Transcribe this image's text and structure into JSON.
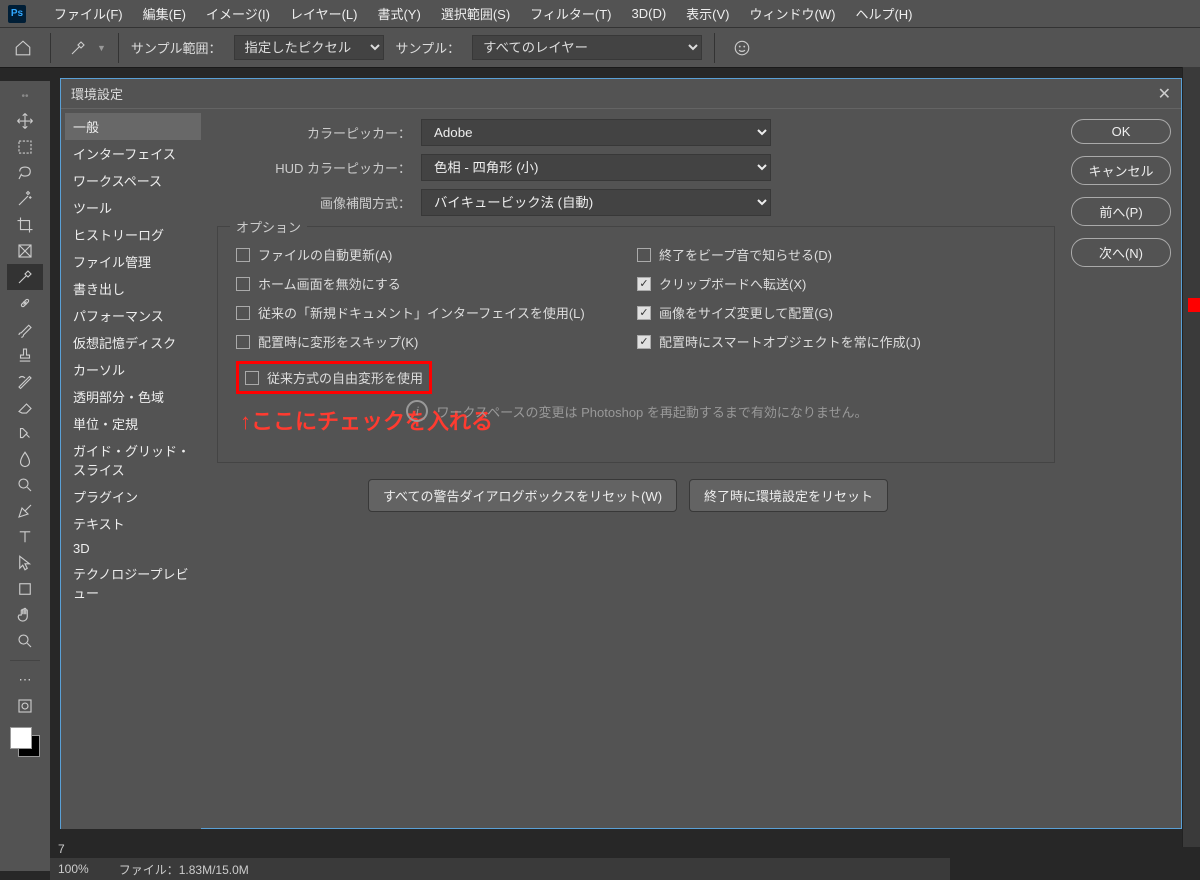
{
  "menubar": {
    "items": [
      "ファイル(F)",
      "編集(E)",
      "イメージ(I)",
      "レイヤー(L)",
      "書式(Y)",
      "選択範囲(S)",
      "フィルター(T)",
      "3D(D)",
      "表示(V)",
      "ウィンドウ(W)",
      "ヘルプ(H)"
    ]
  },
  "optionsbar": {
    "sample_range_label": "サンプル範囲：",
    "sample_range_value": "指定したピクセル",
    "sample_label": "サンプル：",
    "sample_value": "すべてのレイヤー"
  },
  "dialog": {
    "title": "環境設定",
    "actions": {
      "ok": "OK",
      "cancel": "キャンセル",
      "prev": "前へ(P)",
      "next": "次へ(N)"
    },
    "categories": [
      "一般",
      "インターフェイス",
      "ワークスペース",
      "ツール",
      "ヒストリーログ",
      "ファイル管理",
      "書き出し",
      "パフォーマンス",
      "仮想記憶ディスク",
      "カーソル",
      "透明部分・色域",
      "単位・定規",
      "ガイド・グリッド・スライス",
      "プラグイン",
      "テキスト",
      "3D",
      "テクノロジープレビュー"
    ],
    "pickers": {
      "color_label": "カラーピッカー：",
      "color_value": "Adobe",
      "hud_label": "HUD カラーピッカー：",
      "hud_value": "色相 - 四角形 (小)",
      "interp_label": "画像補間方式：",
      "interp_value": "バイキュービック法 (自動)"
    },
    "options_legend": "オプション",
    "left_opts": [
      {
        "label": "ファイルの自動更新(A)",
        "checked": false
      },
      {
        "label": "ホーム画面を無効にする",
        "checked": false
      },
      {
        "label": "従来の「新規ドキュメント」インターフェイスを使用(L)",
        "checked": false
      },
      {
        "label": "配置時に変形をスキップ(K)",
        "checked": false
      },
      {
        "label": "従来方式の自由変形を使用",
        "checked": false,
        "highlight": true
      }
    ],
    "right_opts": [
      {
        "label": "終了をビープ音で知らせる(D)",
        "checked": false
      },
      {
        "label": "クリップボードへ転送(X)",
        "checked": true
      },
      {
        "label": "画像をサイズ変更して配置(G)",
        "checked": true
      },
      {
        "label": "配置時にスマートオブジェクトを常に作成(J)",
        "checked": true
      }
    ],
    "info_pre": "ワークスペースの変更は ",
    "info_mid": "Photoshop",
    "info_post": " を再起動するまで有効になりません。",
    "reset_warnings": "すべての警告ダイアログボックスをリセット(W)",
    "reset_prefs": "終了時に環境設定をリセット"
  },
  "annotation": "↑ここにチェックを入れる",
  "status": {
    "zoom": "100%",
    "file": "ファイル：",
    "size": "1.83M/15.0M"
  },
  "doc_tab": "7"
}
